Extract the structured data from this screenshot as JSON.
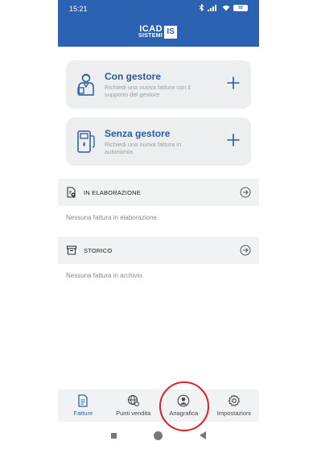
{
  "status_bar": {
    "time": "15:21",
    "battery": "93"
  },
  "header": {
    "logo_top": "ICAD",
    "logo_bottom": "SISTEMI",
    "logo_mark": "IS"
  },
  "cards": [
    {
      "title": "Con gestore",
      "description": "Richiedi una nuova fattura con il supporto del gestore",
      "icon": "attendant-icon",
      "action_icon": "plus-icon"
    },
    {
      "title": "Senza gestore",
      "description": "Richiedi una nuova fattura in autonomia",
      "icon": "fuel-pump-icon",
      "action_icon": "plus-icon"
    }
  ],
  "sections": [
    {
      "label": "IN ELABORAZIONE",
      "empty_text": "Nessuna fattura in elaborazione.",
      "icon": "document-gear-icon"
    },
    {
      "label": "STORICO",
      "empty_text": "Nessuna fattura in archivio.",
      "icon": "archive-icon"
    }
  ],
  "bottom_nav": [
    {
      "label": "Fatture",
      "icon": "invoice-icon",
      "active": true
    },
    {
      "label": "Punti vendita",
      "icon": "globe-settings-icon",
      "active": false
    },
    {
      "label": "Anagrafica",
      "icon": "user-circle-icon",
      "active": false
    },
    {
      "label": "Impostazioni",
      "icon": "gear-icon",
      "active": false
    }
  ],
  "colors": {
    "brand": "#2b63b2",
    "card_title": "#2b5a9e",
    "highlight": "#d9222a"
  }
}
